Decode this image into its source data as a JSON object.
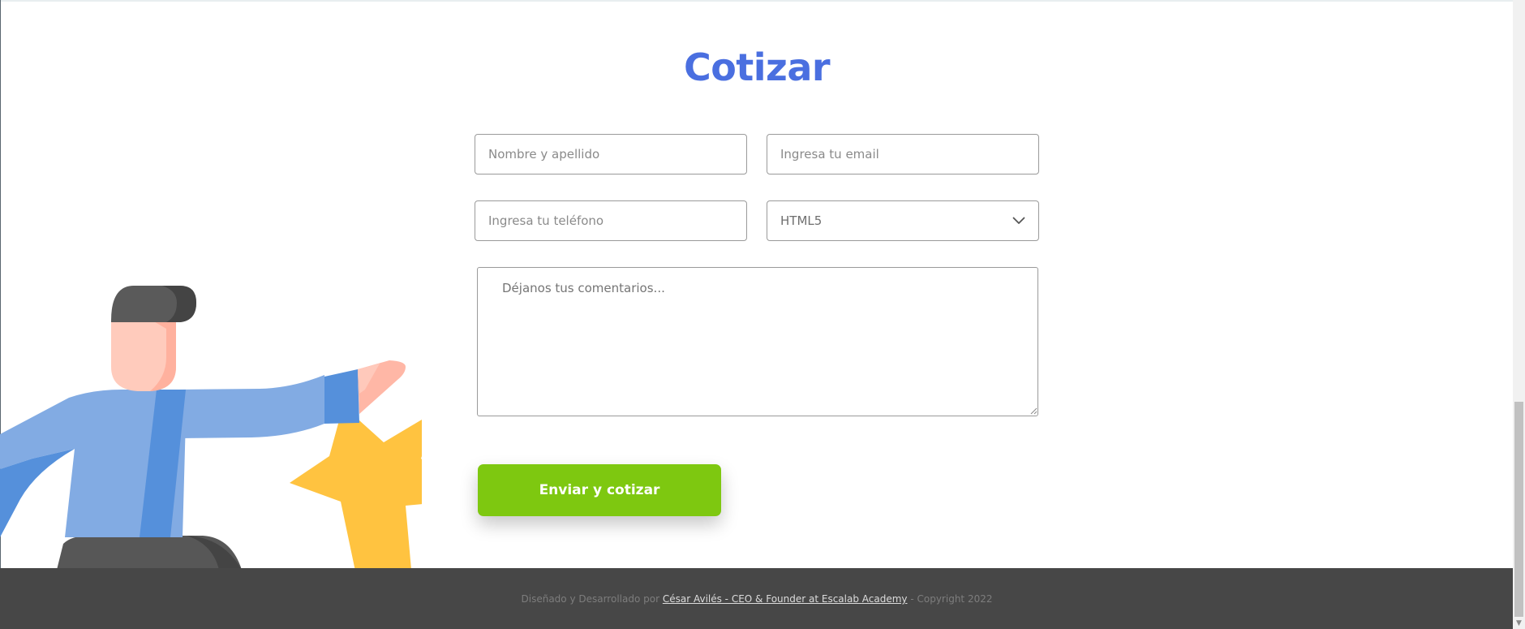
{
  "form": {
    "title": "Cotizar",
    "name_placeholder": "Nombre y apellido",
    "email_placeholder": "Ingresa tu email",
    "phone_placeholder": "Ingresa tu teléfono",
    "technology_selected": "HTML5",
    "comments_placeholder": "Déjanos tus comentarios...",
    "submit_label": "Enviar y cotizar"
  },
  "footer": {
    "prefix": "Diseñado y Desarrollado por",
    "author_link": "César Avilés - CEO & Founder at Escalab Academy",
    "suffix": "- Copyright 2022"
  },
  "icons": {
    "select_arrow": "chevron-down-icon",
    "scroll_arrow": "scroll-down-arrow-icon"
  },
  "colors": {
    "title": "#4a6fe0",
    "button": "#7ec810",
    "footer_bg": "#474747",
    "star": "#ffc340",
    "shirt": "#82abe3",
    "shirt_dark": "#5590db"
  }
}
